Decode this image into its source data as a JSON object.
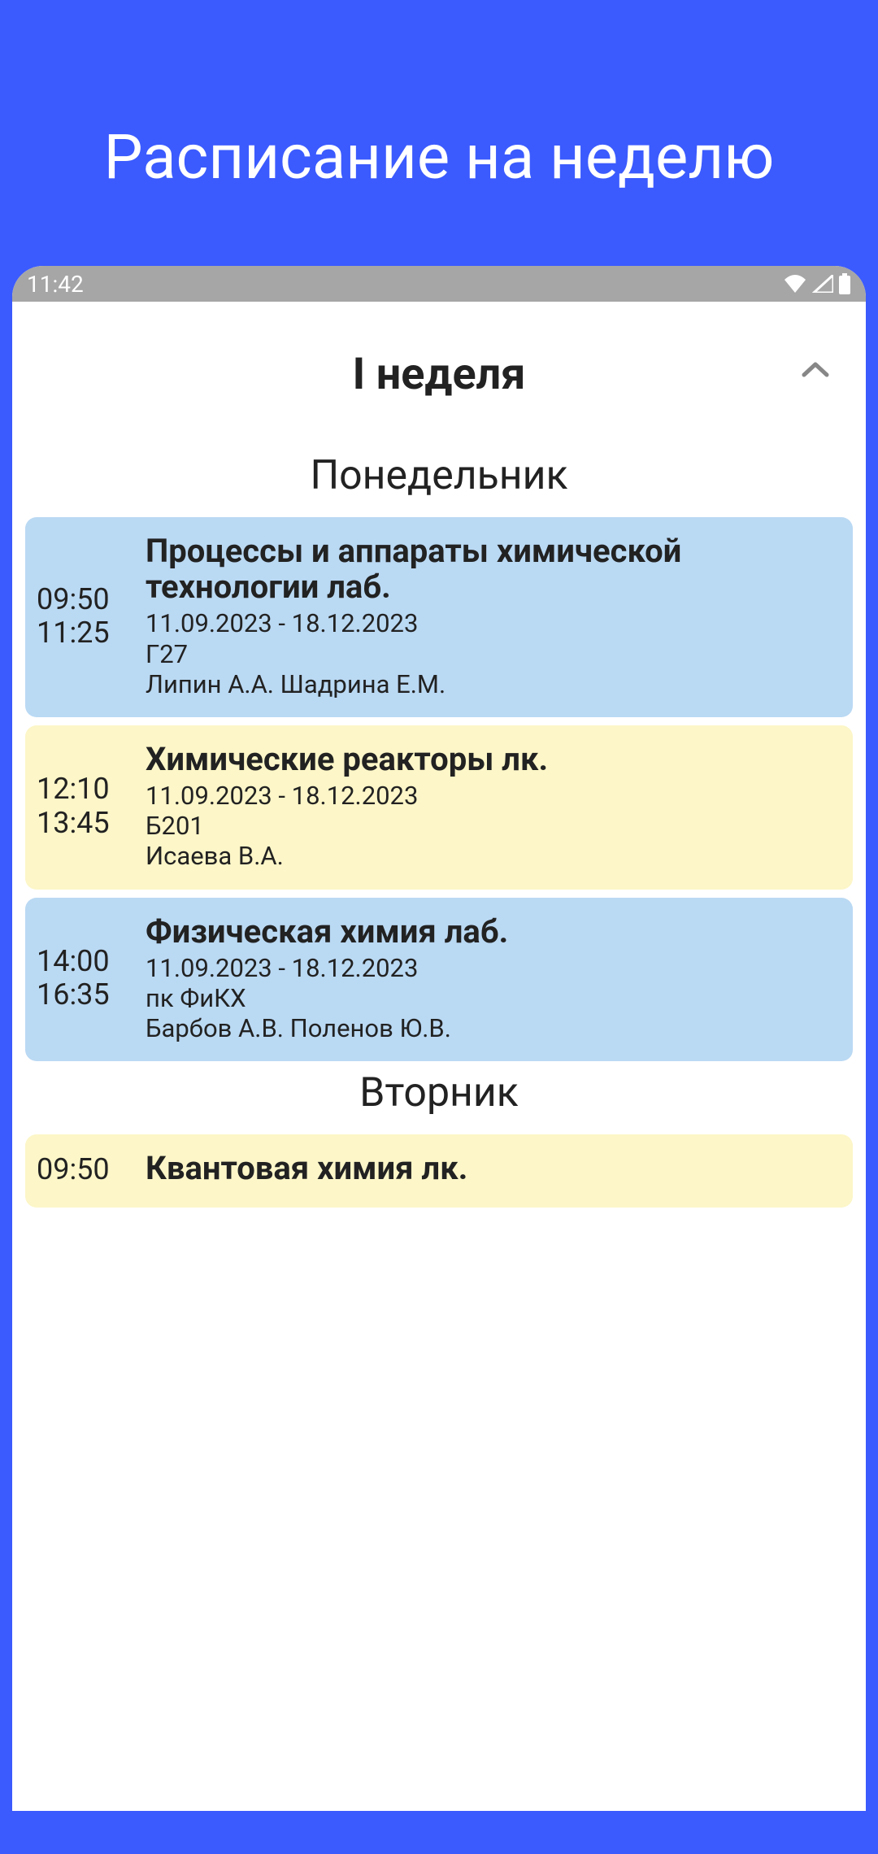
{
  "page_title": "Расписание на неделю",
  "status_bar": {
    "time": "11:42"
  },
  "week_title": "I неделя",
  "days": [
    {
      "name": "Понедельник",
      "lessons": [
        {
          "color": "blue",
          "time_start": "09:50",
          "time_end": "11:25",
          "title": "Процессы и аппараты химической технологии лаб.",
          "period": "11.09.2023 - 18.12.2023",
          "room": "Г27",
          "teachers": "Липин А.А. Шадрина Е.М."
        },
        {
          "color": "yellow",
          "time_start": "12:10",
          "time_end": "13:45",
          "title": "Химические реакторы лк.",
          "period": "11.09.2023 - 18.12.2023",
          "room": "Б201",
          "teachers": "Исаева В.А."
        },
        {
          "color": "blue",
          "time_start": "14:00",
          "time_end": "16:35",
          "title": "Физическая химия лаб.",
          "period": "11.09.2023 - 18.12.2023",
          "room": "пк ФиКХ",
          "teachers": "Барбов А.В. Поленов Ю.В."
        }
      ]
    },
    {
      "name": "Вторник",
      "lessons": [
        {
          "color": "yellow",
          "time_start": "09:50",
          "time_end": "",
          "title": "Квантовая химия лк.",
          "period": "",
          "room": "",
          "teachers": ""
        }
      ]
    }
  ]
}
